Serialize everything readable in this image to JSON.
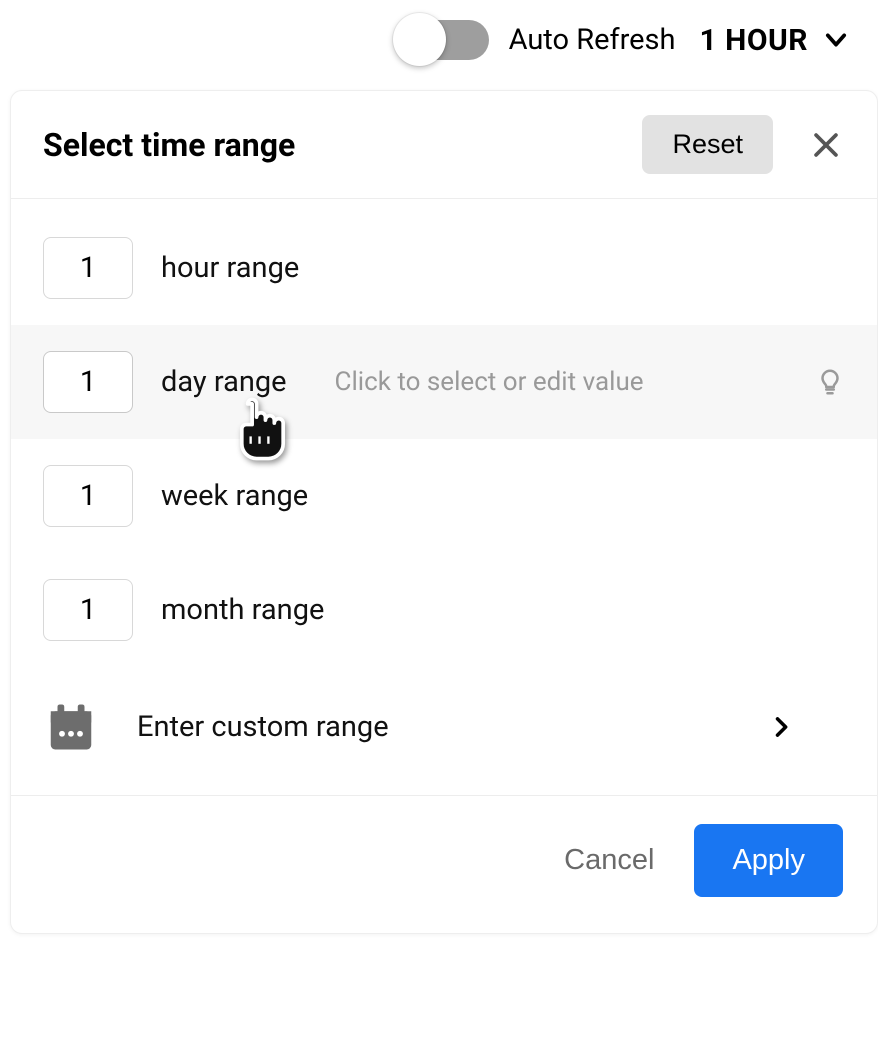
{
  "topbar": {
    "toggle_label": "Auto Refresh",
    "toggle_on": false,
    "selector_value": "1 HOUR"
  },
  "panel": {
    "title": "Select time range",
    "reset_label": "Reset",
    "options": [
      {
        "value": "1",
        "label": "hour range"
      },
      {
        "value": "1",
        "label": "day range"
      },
      {
        "value": "1",
        "label": "week range"
      },
      {
        "value": "1",
        "label": "month range"
      }
    ],
    "hovered_hint": "Click to select or edit value",
    "custom_label": "Enter custom range",
    "cancel_label": "Cancel",
    "apply_label": "Apply"
  }
}
